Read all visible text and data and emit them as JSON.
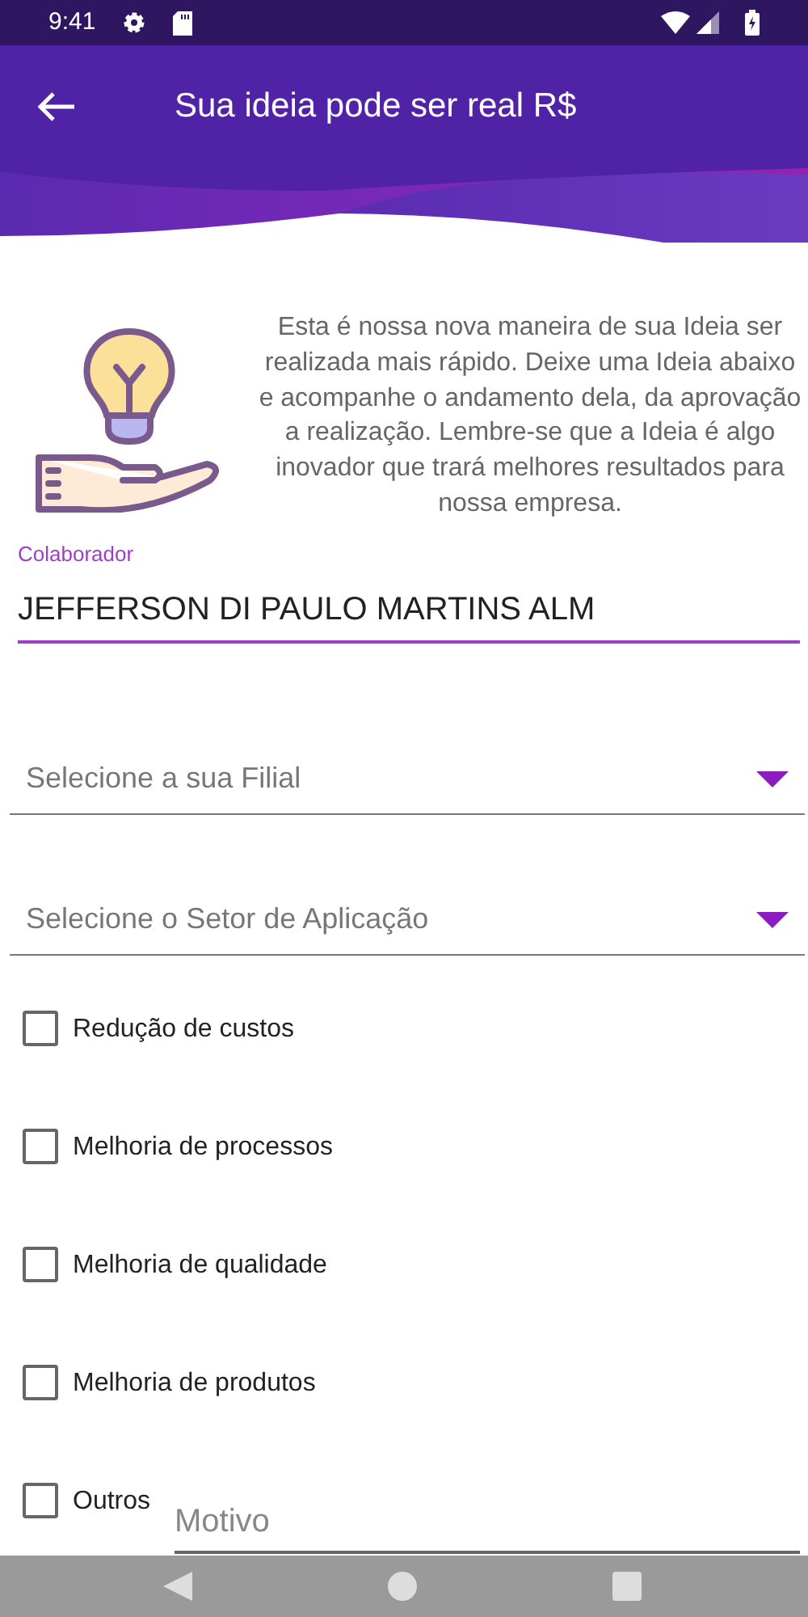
{
  "status_bar": {
    "time": "9:41"
  },
  "app_bar": {
    "title": "Sua ideia pode ser real R$"
  },
  "intro": {
    "text": "Esta é nossa nova maneira de sua Ideia ser realizada mais rápido. Deixe uma Ideia abaixo e acompanhe o andamento dela, da aprovação a realização. Lembre-se que a Ideia é algo inovador que trará melhores resultados para nossa empresa."
  },
  "collaborator": {
    "label": "Colaborador",
    "value": "JEFFERSON DI PAULO MARTINS ALM"
  },
  "dropdowns": [
    {
      "placeholder": "Selecione a sua Filial"
    },
    {
      "placeholder": "Selecione o Setor de Aplicação"
    }
  ],
  "checkboxes": [
    {
      "label": "Redução de custos",
      "checked": false
    },
    {
      "label": "Melhoria de processos",
      "checked": false
    },
    {
      "label": "Melhoria de qualidade",
      "checked": false
    },
    {
      "label": "Melhoria de produtos",
      "checked": false
    },
    {
      "label": "Outros",
      "checked": false
    }
  ],
  "motivo": {
    "placeholder": "Motivo"
  }
}
